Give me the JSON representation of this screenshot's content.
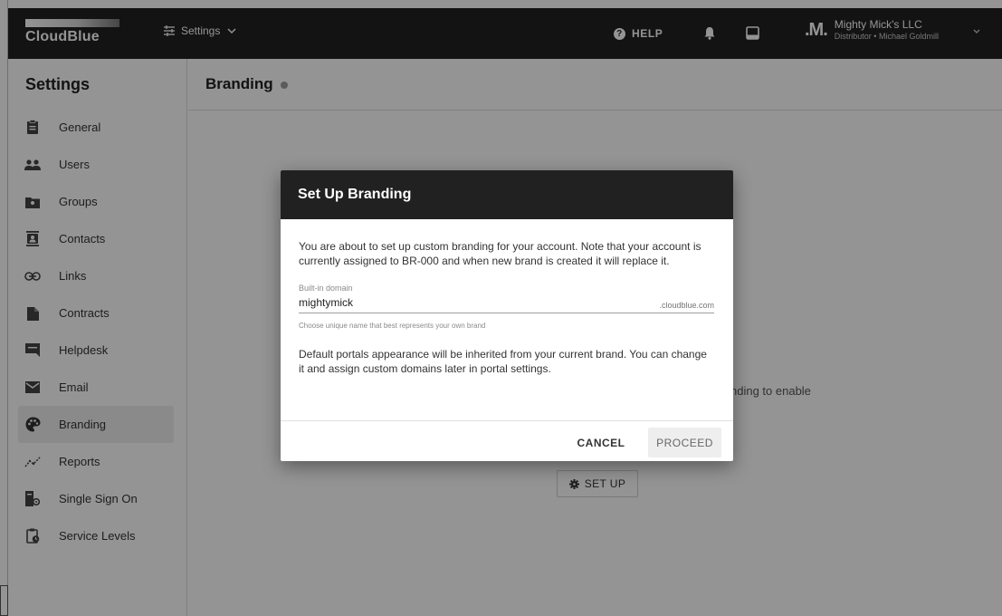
{
  "app": {
    "logo_text": "CloudBlue",
    "switcher_label": "Settings",
    "help_label": "HELP",
    "account_logo": ".M.",
    "account_name": "Mighty Mick's LLC",
    "account_sub": "Distributor • Michael Goldmill"
  },
  "sidebar": {
    "title": "Settings",
    "items": [
      {
        "label": "General",
        "icon": "clipboard-icon"
      },
      {
        "label": "Users",
        "icon": "users-icon"
      },
      {
        "label": "Groups",
        "icon": "groups-icon"
      },
      {
        "label": "Contacts",
        "icon": "contacts-icon"
      },
      {
        "label": "Links",
        "icon": "link-icon"
      },
      {
        "label": "Contracts",
        "icon": "document-icon"
      },
      {
        "label": "Helpdesk",
        "icon": "chat-icon"
      },
      {
        "label": "Email",
        "icon": "mail-icon"
      },
      {
        "label": "Branding",
        "icon": "palette-icon",
        "active": true
      },
      {
        "label": "Reports",
        "icon": "chart-icon"
      },
      {
        "label": "Single Sign On",
        "icon": "sso-icon"
      },
      {
        "label": "Service Levels",
        "icon": "service-level-icon"
      }
    ]
  },
  "main": {
    "title": "Branding",
    "empty_text": "nding to enable",
    "setup_label": "SET UP"
  },
  "dialog": {
    "title": "Set Up Branding",
    "intro": "You are about to set up custom branding for your account. Note that your account is currently assigned to BR-000 and when new brand is created it will replace it.",
    "field_label": "Built-in domain",
    "field_value": "mightymick",
    "field_suffix": ".cloudblue.com",
    "field_hint": "Choose unique name that best represents your own brand",
    "note": "Default portals appearance will be inherited from your current brand. You can change it and assign custom domains later in portal settings.",
    "cancel_label": "CANCEL",
    "proceed_label": "PROCEED"
  },
  "colors": {
    "topbar": "#212121",
    "dialog_header": "#212121",
    "overlay": "rgba(0,0,0,0.42)"
  }
}
